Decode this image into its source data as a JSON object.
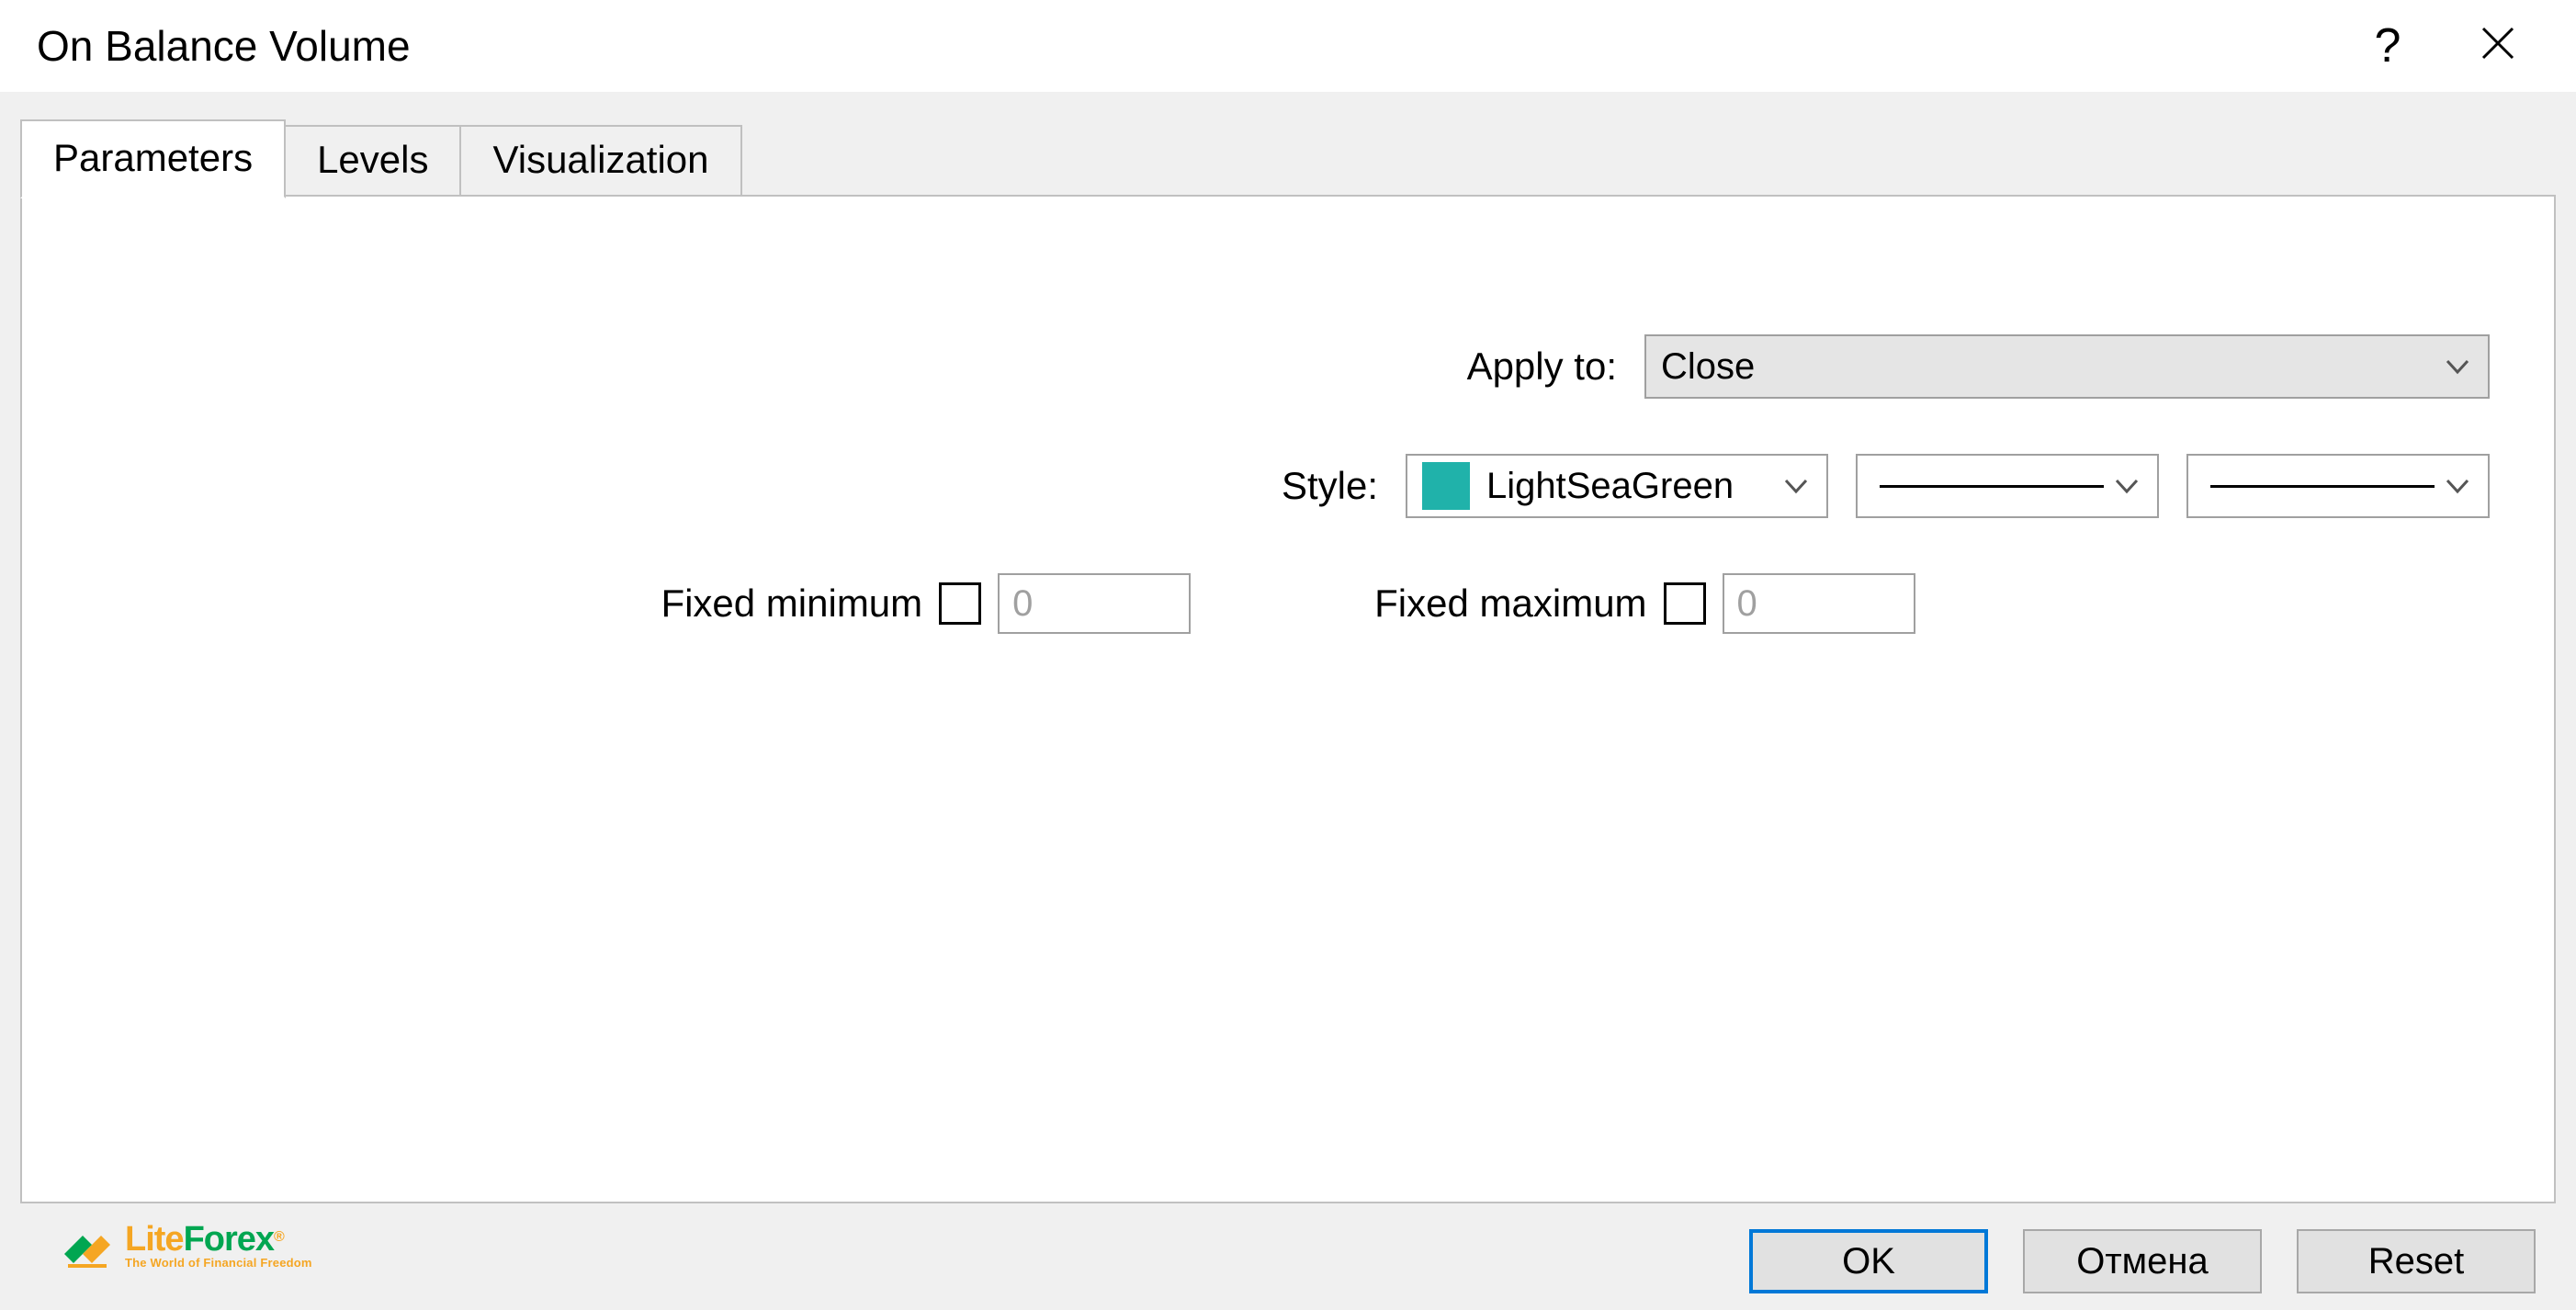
{
  "window": {
    "title": "On Balance Volume"
  },
  "tabs": {
    "parameters": "Parameters",
    "levels": "Levels",
    "visualization": "Visualization",
    "active": "parameters"
  },
  "form": {
    "apply_to_label": "Apply to:",
    "apply_to_value": "Close",
    "style_label": "Style:",
    "style_color_name": "LightSeaGreen",
    "style_color_hex": "#20b2aa",
    "fixed_min_label": "Fixed minimum",
    "fixed_min_checked": false,
    "fixed_min_value": "0",
    "fixed_max_label": "Fixed maximum",
    "fixed_max_checked": false,
    "fixed_max_value": "0"
  },
  "buttons": {
    "ok": "OK",
    "cancel": "Отмена",
    "reset": "Reset"
  },
  "logo": {
    "lite": "Lite",
    "forex": "Forex",
    "tagline": "The World of Financial Freedom"
  }
}
